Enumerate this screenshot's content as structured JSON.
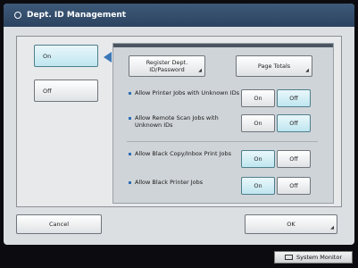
{
  "window": {
    "title": "Dept. ID Management"
  },
  "mode": {
    "on_label": "On",
    "off_label": "Off",
    "selected": "On"
  },
  "actions": {
    "register_label": "Register Dept. ID/Password",
    "page_totals_label": "Page Totals"
  },
  "settings": [
    {
      "label": "Allow Printer Jobs with Unknown IDs",
      "on_label": "On",
      "off_label": "Off",
      "selected": "Off"
    },
    {
      "label": "Allow Remote Scan Jobs with Unknown IDs",
      "on_label": "On",
      "off_label": "Off",
      "selected": "Off"
    },
    {
      "label": "Allow Black Copy/Inbox Print Jobs",
      "on_label": "On",
      "off_label": "Off",
      "selected": "On"
    },
    {
      "label": "Allow Black Printer Jobs",
      "on_label": "On",
      "off_label": "Off",
      "selected": "On"
    }
  ],
  "footer": {
    "cancel_label": "Cancel",
    "ok_label": "OK"
  },
  "statusbar": {
    "system_monitor_label": "System Monitor"
  }
}
